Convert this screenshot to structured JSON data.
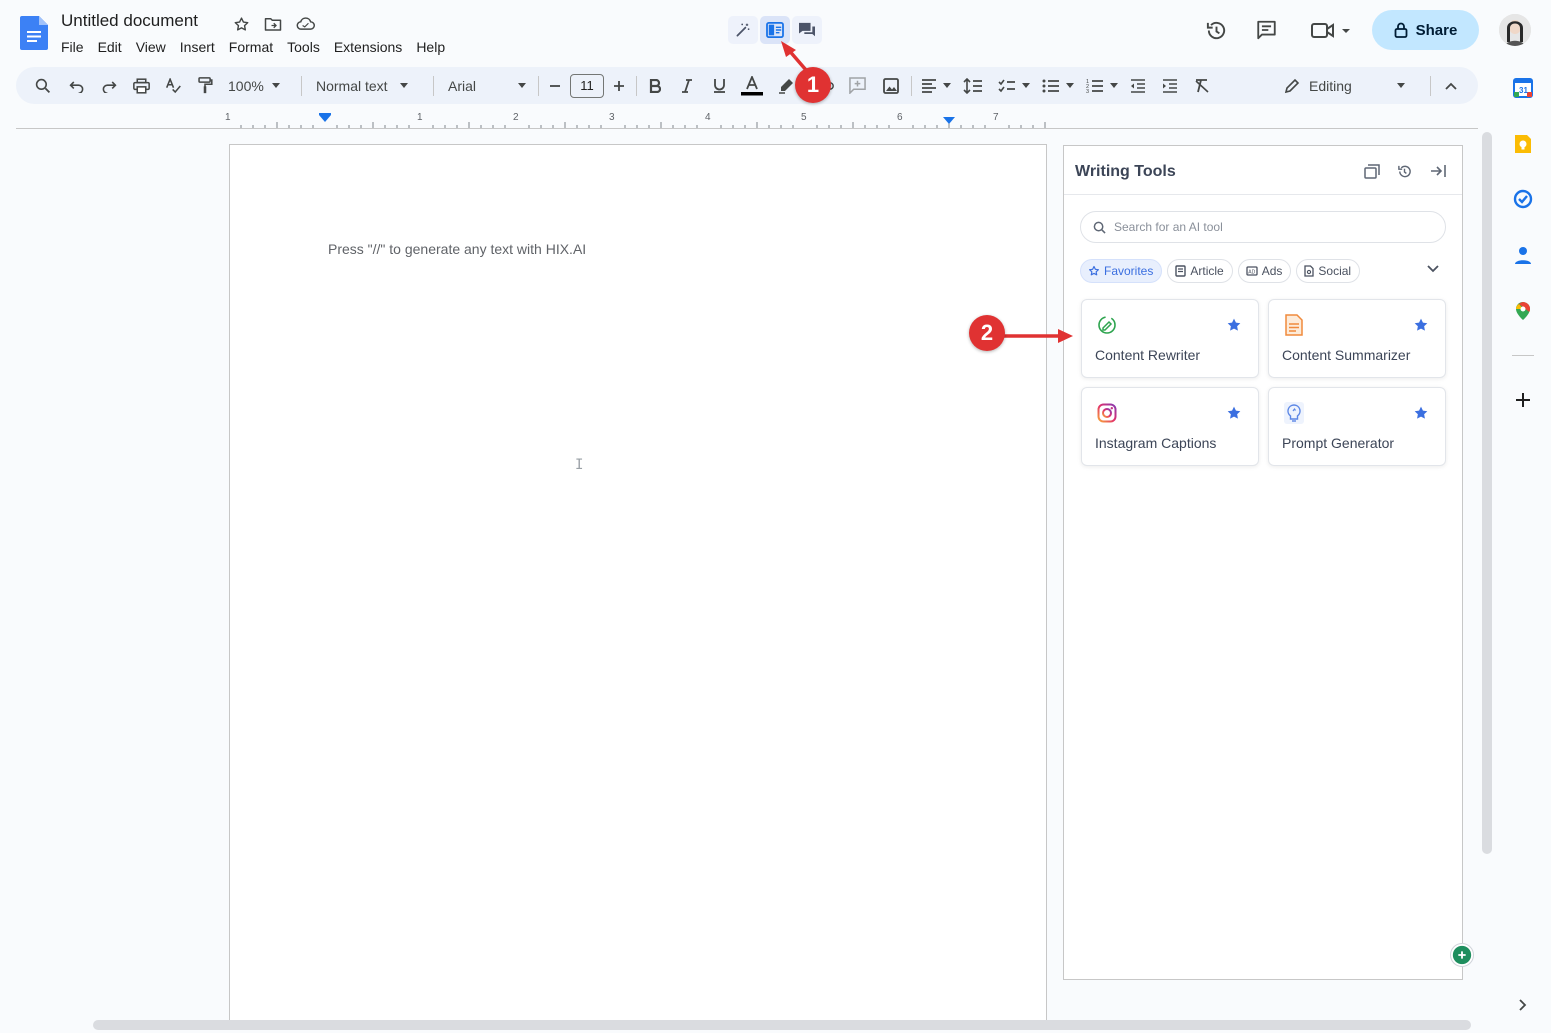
{
  "document": {
    "title": "Untitled document",
    "menus": [
      "File",
      "Edit",
      "View",
      "Insert",
      "Format",
      "Tools",
      "Extensions",
      "Help"
    ],
    "hint_text": "Press \"//\" to generate any text with HIX.AI"
  },
  "top_bar": {
    "share_label": "Share"
  },
  "toolbar": {
    "zoom": "100%",
    "style": "Normal text",
    "font": "Arial",
    "font_size": "11",
    "mode": "Editing"
  },
  "ruler": {
    "labels": [
      "1",
      "1",
      "2",
      "3",
      "4",
      "5",
      "6",
      "7"
    ]
  },
  "writing_tools": {
    "title": "Writing Tools",
    "search_placeholder": "Search for an AI tool",
    "chips": [
      {
        "label": "Favorites",
        "active": true
      },
      {
        "label": "Article",
        "active": false
      },
      {
        "label": "Ads",
        "active": false
      },
      {
        "label": "Social",
        "active": false
      }
    ],
    "cards": [
      {
        "label": "Content Rewriter",
        "icon": "rewriter-icon",
        "starred": true
      },
      {
        "label": "Content Summarizer",
        "icon": "summarizer-icon",
        "starred": true
      },
      {
        "label": "Instagram Captions",
        "icon": "instagram-icon",
        "starred": true
      },
      {
        "label": "Prompt Generator",
        "icon": "prompt-icon",
        "starred": true
      }
    ]
  },
  "annotations": {
    "badge1": "1",
    "badge2": "2"
  },
  "colors": {
    "accent": "#1a73e8",
    "share_bg": "#c2e7ff",
    "annotation_red": "#e03232",
    "star_blue": "#3b6fe0"
  }
}
